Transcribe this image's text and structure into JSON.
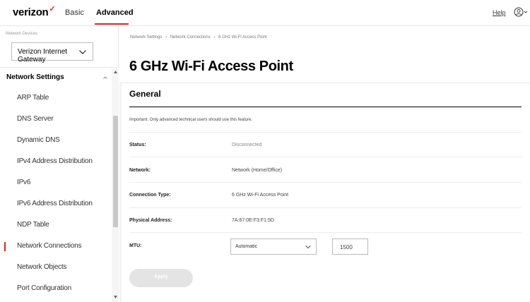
{
  "header": {
    "logo_text": "verizon",
    "logo_mark": "✓",
    "tabs": [
      {
        "label": "Basic",
        "active": false
      },
      {
        "label": "Advanced",
        "active": true
      }
    ],
    "help_label": "Help",
    "user_icon": "user-circle-icon"
  },
  "sidebar": {
    "devices_label": "Network Devices",
    "device_selected": "Verizon Internet Gateway",
    "section_label": "Network Settings",
    "items": [
      {
        "label": "ARP Table"
      },
      {
        "label": "DNS Server"
      },
      {
        "label": "Dynamic DNS"
      },
      {
        "label": "IPv4 Address Distribution"
      },
      {
        "label": "IPv6"
      },
      {
        "label": "IPv6 Address Distribution"
      },
      {
        "label": "NDP Table"
      },
      {
        "label": "Network Connections",
        "active": true
      },
      {
        "label": "Network Objects"
      },
      {
        "label": "Port Configuration"
      }
    ]
  },
  "breadcrumb": [
    "Network Settings",
    "›",
    "Network Connections",
    "›",
    "6 GHz Wi-Fi Access Point"
  ],
  "page": {
    "title": "6 GHz Wi-Fi Access Point",
    "card_title": "General",
    "important_note": "Important: Only advanced technical users should use this feature.",
    "fields": {
      "status_label": "Status:",
      "status_value": "Disconnected",
      "network_label": "Network:",
      "network_value": "Network (Home/Office)",
      "conn_type_label": "Connection Type:",
      "conn_type_value": "6 GHz Wi-Fi Access Point",
      "phys_addr_label": "Physical Address:",
      "phys_addr_value": "7A:67:0E:F3:F1:5D",
      "mtu_label": "MTU:",
      "mtu_mode": "Automatic",
      "mtu_value": "1500"
    },
    "apply_label": "Apply"
  },
  "colors": {
    "accent": "#d52b1e",
    "apply_disabled": "#e4e4e4"
  }
}
